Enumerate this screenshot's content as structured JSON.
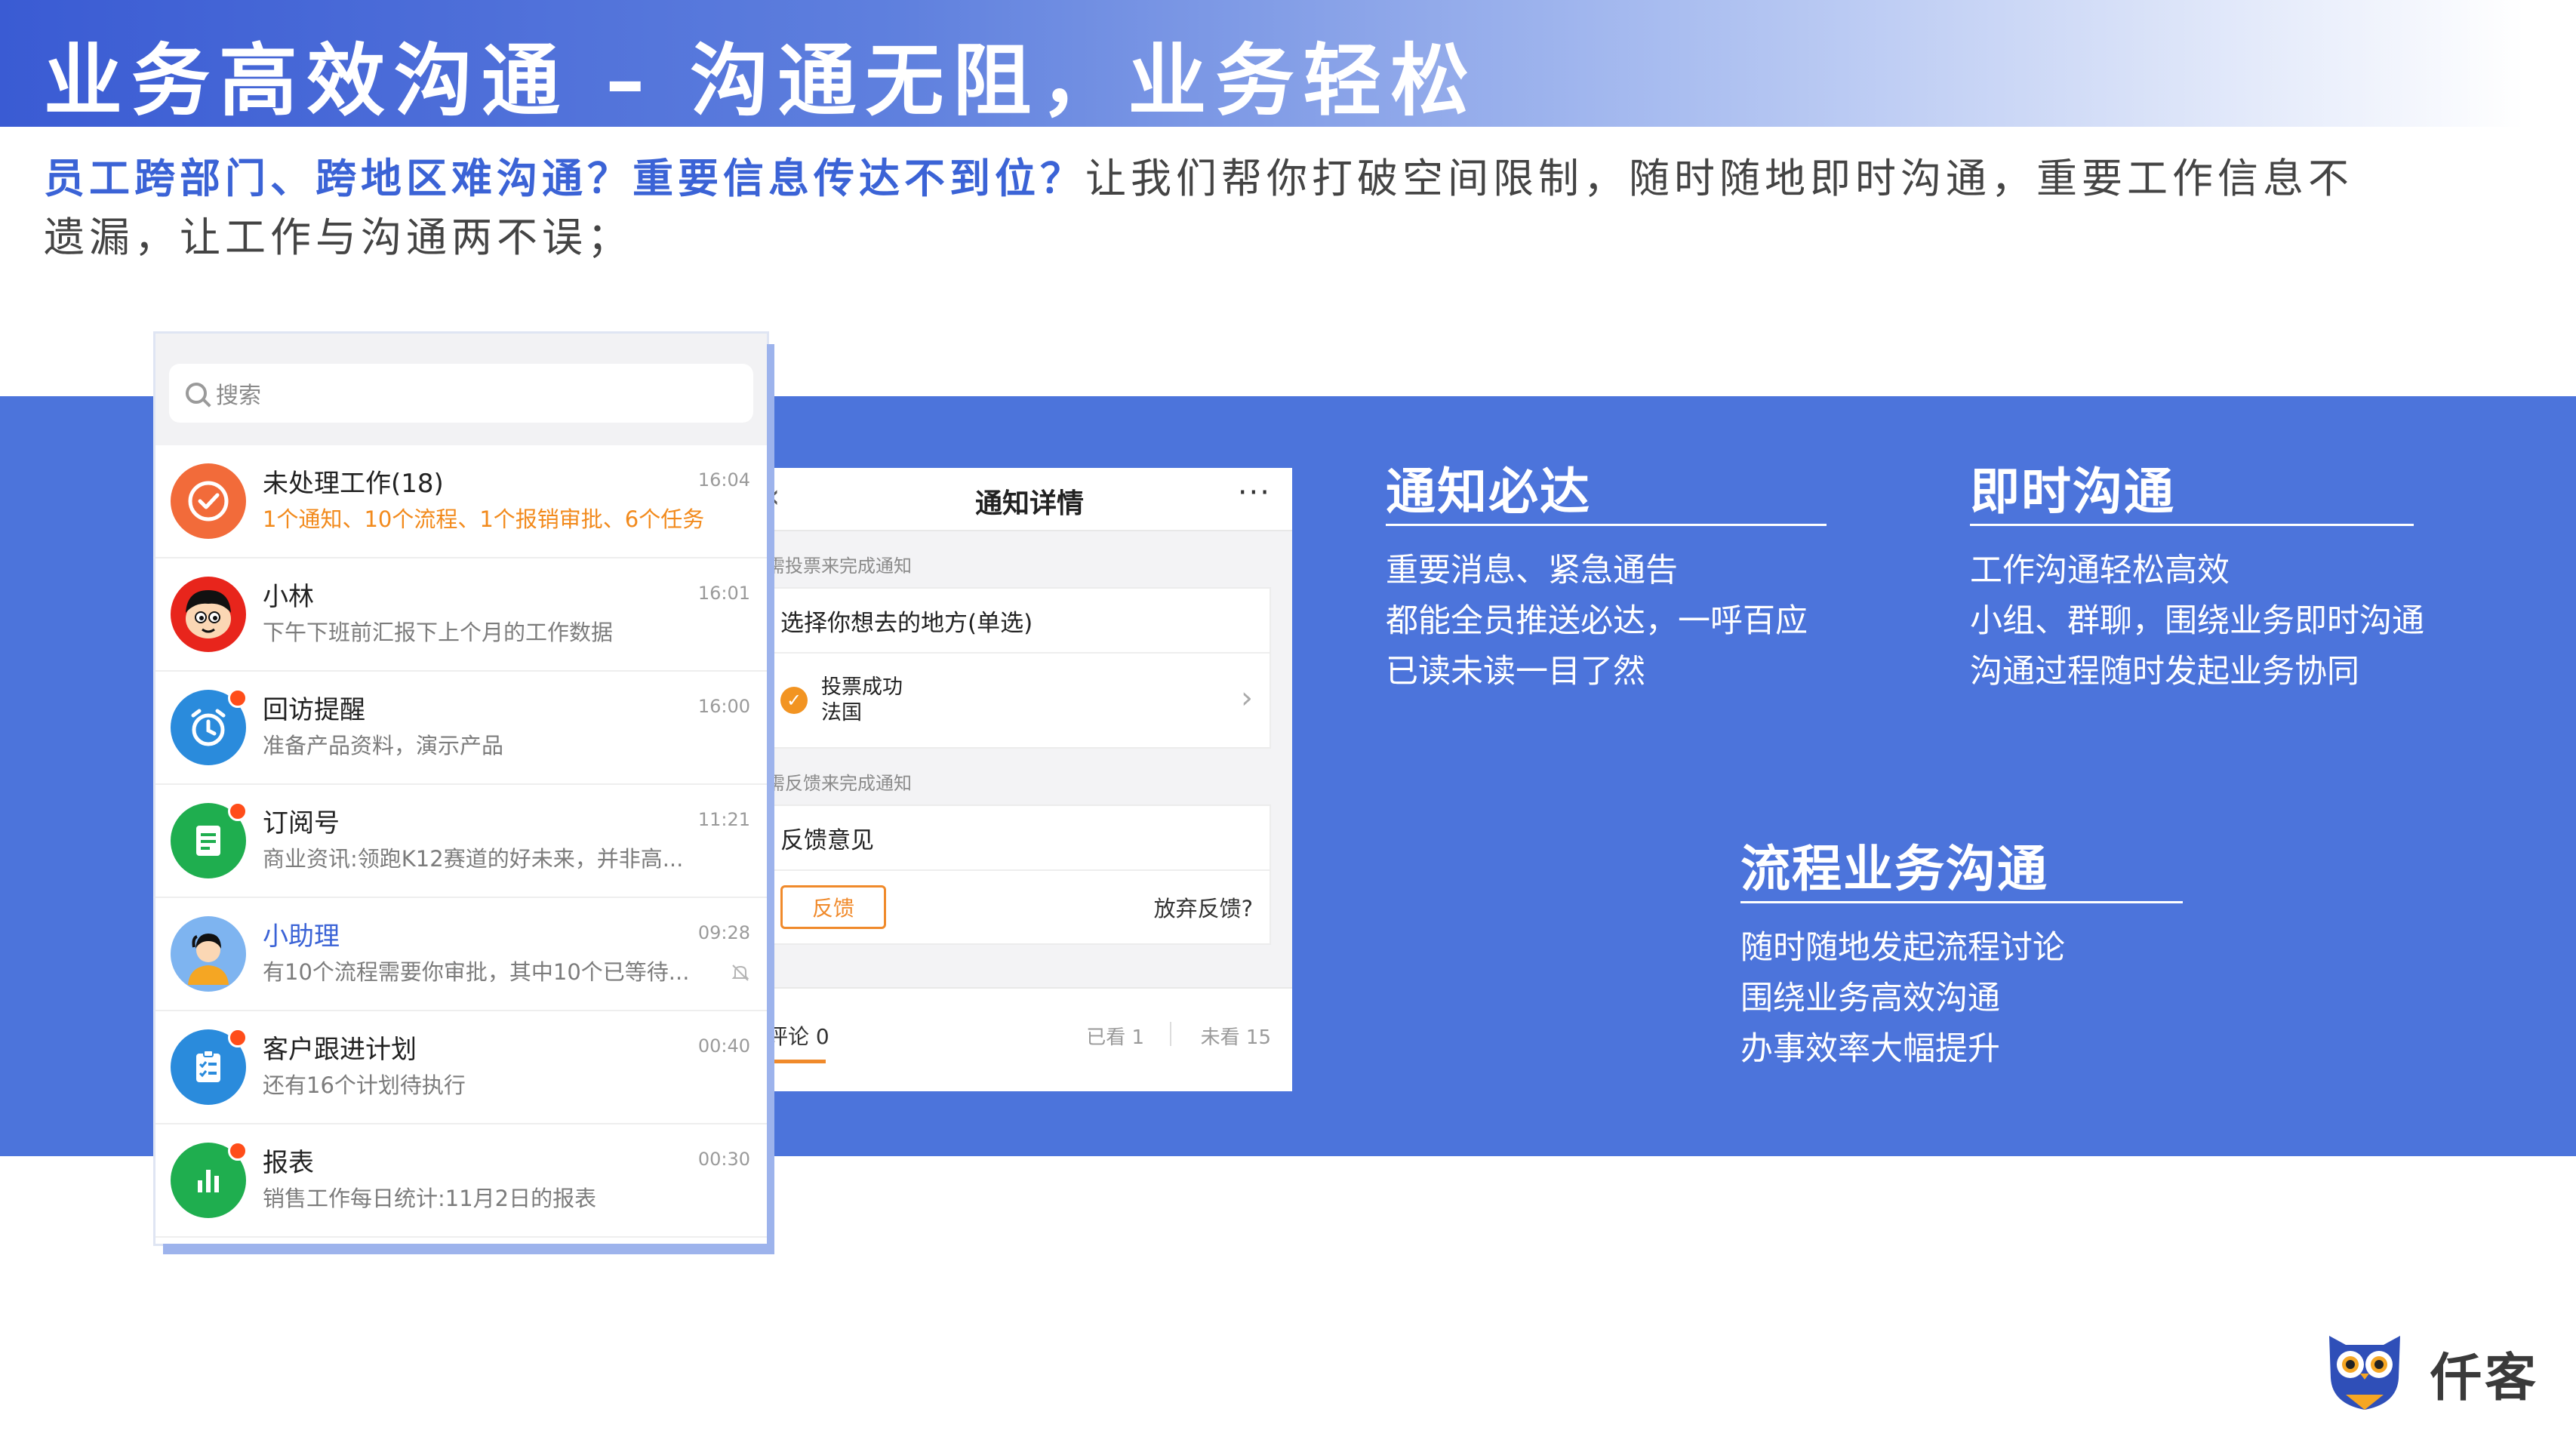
{
  "header": {
    "title": "业务高效沟通 – 沟通无阻，业务轻松"
  },
  "intro": {
    "highlight": "员工跨部门、跨地区难沟通？重要信息传达不到位？",
    "rest": "让我们帮你打破空间限制，随时随地即时沟通，重要工作信息不遗漏，让工作与沟通两不误；"
  },
  "chat_list": {
    "search_placeholder": "搜索",
    "items": [
      {
        "name": "未处理工作(18)",
        "sub": "1个通知、10个流程、1个报销审批、6个任务",
        "time": "16:04"
      },
      {
        "name": "小林",
        "sub": "下午下班前汇报下上个月的工作数据",
        "time": "16:01"
      },
      {
        "name": "回访提醒",
        "sub": "准备产品资料，演示产品",
        "time": "16:00"
      },
      {
        "name": "订阅号",
        "sub": "商业资讯:领跑K12赛道的好未来，并非高...",
        "time": "11:21"
      },
      {
        "name": "小助理",
        "sub": "有10个流程需要你审批，其中10个已等待...",
        "time": "09:28"
      },
      {
        "name": "客户跟进计划",
        "sub": "还有16个计划待执行",
        "time": "00:40"
      },
      {
        "name": "报表",
        "sub": "销售工作每日统计:11月2日的报表",
        "time": "00:30"
      }
    ]
  },
  "notice": {
    "title": "通知详情",
    "more": "···",
    "back": "‹",
    "section1_label": "需投票来完成通知",
    "vote_question": "选择你想去的地方(单选)",
    "vote_result_line1": "投票成功",
    "vote_result_line2": "法国",
    "section2_label": "需反馈来完成通知",
    "feedback_title": "反馈意见",
    "feedback_button": "反馈",
    "feedback_abandon": "放弃反馈?",
    "comment": "评论 0",
    "read": "已看 1",
    "unread": "未看 15"
  },
  "features": [
    {
      "title": "通知必达",
      "lines": [
        "重要消息、紧急通告",
        "都能全员推送必达，一呼百应",
        "已读未读一目了然"
      ]
    },
    {
      "title": "即时沟通",
      "lines": [
        "工作沟通轻松高效",
        "小组、群聊，围绕业务即时沟通",
        "沟通过程随时发起业务协同"
      ]
    },
    {
      "title": "流程业务沟通",
      "lines": [
        "随时随地发起流程讨论",
        "围绕业务高效沟通",
        "办事效率大幅提升"
      ]
    }
  ],
  "logo": {
    "text": "仟客"
  },
  "colors": {
    "brand_blue": "#4c74db",
    "accent_orange": "#f08a2b",
    "notify_red": "#ff4d1a"
  }
}
